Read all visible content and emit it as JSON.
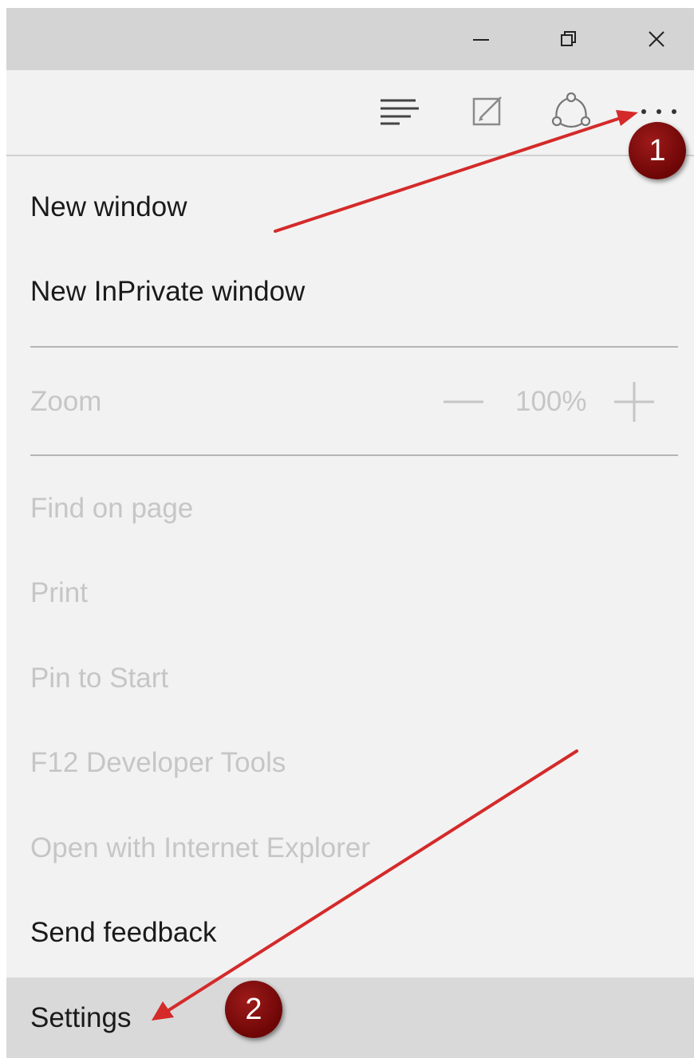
{
  "titlebar": {
    "minimize_icon": "minimize-icon",
    "restore_icon": "restore-icon",
    "close_icon": "close-icon"
  },
  "toolbar": {
    "icons": [
      "hub-icon",
      "web-note-icon",
      "share-icon",
      "more-icon"
    ]
  },
  "menu": {
    "new_window": "New window",
    "new_inprivate_window": "New InPrivate window",
    "zoom_label": "Zoom",
    "zoom_value": "100%",
    "find_on_page": "Find on page",
    "print": "Print",
    "pin_to_start": "Pin to Start",
    "dev_tools": "F12 Developer Tools",
    "open_with_ie": "Open with Internet Explorer",
    "send_feedback": "Send feedback",
    "settings": "Settings"
  },
  "annotations": {
    "step_1": "1",
    "step_2": "2",
    "badge_color": "#7a0a0a",
    "arrow_color": "#d42a2a"
  },
  "colors": {
    "titlebar_bg": "#d4d4d4",
    "menu_bg": "#f2f2f2",
    "settings_highlight": "#d9d9d9",
    "disabled_text": "#c6c6c6"
  }
}
